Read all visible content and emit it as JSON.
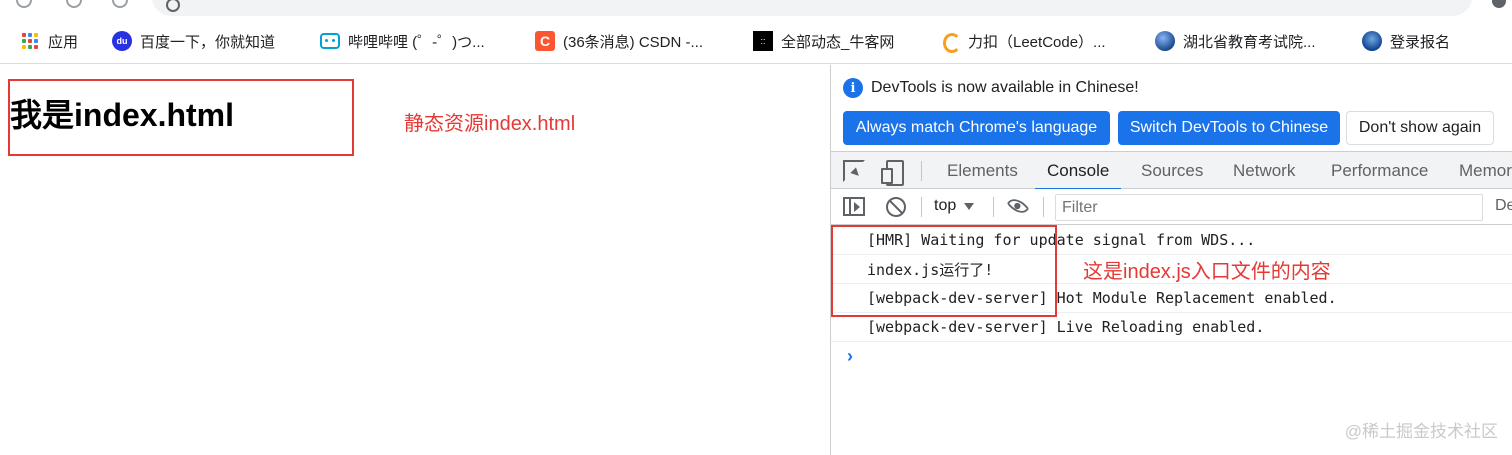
{
  "bookmarks": [
    {
      "label": "应用",
      "icon": "apps-grid-icon"
    },
    {
      "label": "百度一下，你就知道",
      "icon": "baidu-icon"
    },
    {
      "label": "哔哩哔哩 (゜-゜)つ...",
      "icon": "bilibili-icon"
    },
    {
      "label": "(36条消息) CSDN -...",
      "icon": "csdn-icon"
    },
    {
      "label": "全部动态_牛客网",
      "icon": "nowcoder-icon"
    },
    {
      "label": "力扣（LeetCode）...",
      "icon": "leetcode-icon"
    },
    {
      "label": "湖北省教育考试院...",
      "icon": "hubei-exam-icon"
    },
    {
      "label": "登录报名",
      "icon": "login-icon"
    }
  ],
  "page": {
    "heading": "我是index.html",
    "annotation": "静态资源index.html"
  },
  "devtools": {
    "info_message": "DevTools is now available in Chinese!",
    "buttons": {
      "match": "Always match Chrome's language",
      "switch": "Switch DevTools to Chinese",
      "dont_show": "Don't show again"
    },
    "tabs": [
      "Elements",
      "Console",
      "Sources",
      "Network",
      "Performance",
      "Memor"
    ],
    "active_tab": "Console",
    "toolbar": {
      "context": "top",
      "filter_placeholder": "Filter",
      "levels": "De"
    },
    "console_messages": [
      "[HMR] Waiting for update signal from WDS...",
      "index.js运行了!",
      "[webpack-dev-server] Hot Module Replacement enabled.",
      "[webpack-dev-server] Live Reloading enabled."
    ],
    "prompt": "›",
    "annotation": "这是index.js入口文件的内容"
  },
  "watermark": "@稀土掘金技术社区",
  "colors": {
    "annotation": "#e53935",
    "primary_button": "#1a73e8",
    "tabbar_bg": "#f1f3f4"
  }
}
